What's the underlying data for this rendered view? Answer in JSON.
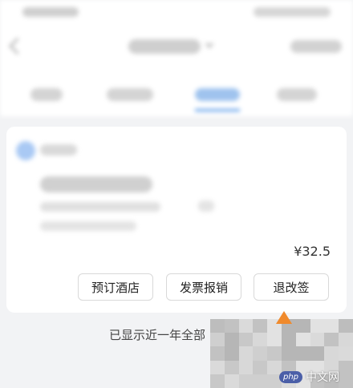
{
  "card": {
    "price": "¥32.5",
    "actions": [
      "预订酒店",
      "发票报销",
      "退改签"
    ]
  },
  "footer": {
    "text": "已显示近一年全部"
  },
  "watermark": {
    "logo": "php",
    "text": "中文网"
  },
  "colors": {
    "accent": "#5a9be8",
    "arrow": "#f08a2c"
  }
}
